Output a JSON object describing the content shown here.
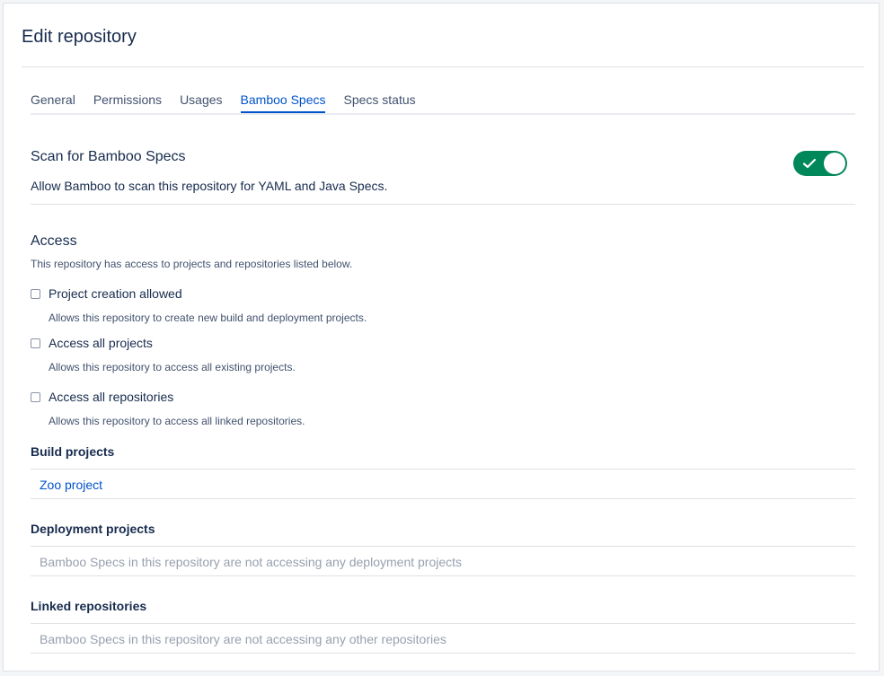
{
  "page": {
    "title": "Edit repository"
  },
  "tabs": [
    {
      "label": "General"
    },
    {
      "label": "Permissions"
    },
    {
      "label": "Usages"
    },
    {
      "label": "Bamboo Specs",
      "active": true
    },
    {
      "label": "Specs status"
    }
  ],
  "scan": {
    "title": "Scan for Bamboo Specs",
    "description": "Allow Bamboo to scan this repository for YAML and Java Specs.",
    "enabled": true
  },
  "access": {
    "title": "Access",
    "description": "This repository has access to projects and repositories listed below.",
    "options": [
      {
        "label": "Project creation allowed",
        "help": "Allows this repository to create new build and deployment projects.",
        "checked": false
      },
      {
        "label": "Access all projects",
        "help": "Allows this repository to access all existing projects.",
        "checked": false
      },
      {
        "label": "Access all repositories",
        "help": "Allows this repository to access all linked repositories.",
        "checked": false
      }
    ]
  },
  "build_projects": {
    "label": "Build projects",
    "items": [
      "Zoo project"
    ]
  },
  "deployment_projects": {
    "label": "Deployment projects",
    "empty": "Bamboo Specs in this repository are not accessing any deployment projects"
  },
  "linked_repositories": {
    "label": "Linked repositories",
    "empty": "Bamboo Specs in this repository are not accessing any other repositories"
  },
  "colors": {
    "accent": "#0052cc",
    "toggle_on": "#00875a",
    "muted": "#97a0af",
    "text": "#172b4d"
  },
  "icons": {
    "toggle_check": "check-icon"
  }
}
